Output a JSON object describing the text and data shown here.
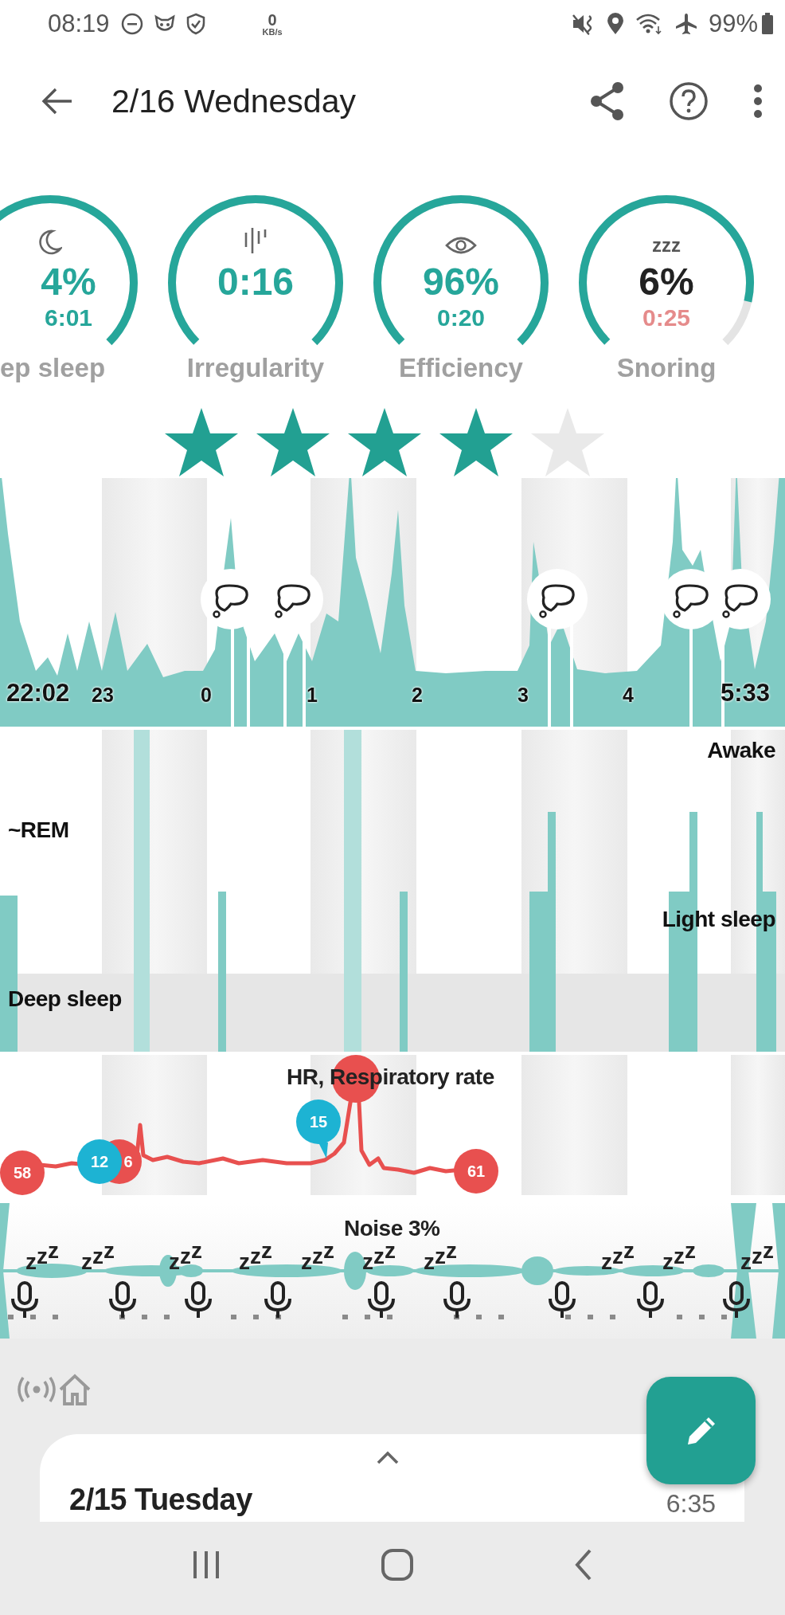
{
  "status_bar": {
    "time": "08:19",
    "net_speed": "0",
    "net_unit": "KB/s",
    "battery": "99%"
  },
  "app_bar": {
    "title": "2/16 Wednesday"
  },
  "gauges": [
    {
      "kind": "moon",
      "value": "4%",
      "detail": "6:01",
      "label": "ep sleep",
      "level": 1,
      "warning": false
    },
    {
      "kind": "bars",
      "value": "0:16",
      "label": "Irregularity",
      "level": 1,
      "warning": false
    },
    {
      "kind": "eye",
      "value": "96%",
      "detail": "0:20",
      "label": "Efficiency",
      "level": 1,
      "warning": false
    },
    {
      "kind": "snore",
      "icon_text": "zzz",
      "value": "6%",
      "detail": "0:25",
      "label": "Snoring",
      "level": 0.88,
      "warning": true
    }
  ],
  "rating": {
    "stars": 4
  },
  "activity_chart": {
    "time_labels": [
      "22:02",
      "23",
      "0",
      "1",
      "2",
      "3",
      "4",
      "5:33"
    ]
  },
  "sleep_stages": {
    "labels": [
      "Awake",
      "~REM",
      "Light sleep",
      "Deep sleep"
    ]
  },
  "hr_chart": {
    "title": "HR, Respiratory rate",
    "markers": [
      {
        "text": "58",
        "color": "#e8504f"
      },
      {
        "text": "6",
        "color": "#e8504f"
      },
      {
        "text": "12",
        "color": "#1db3d3"
      },
      {
        "text": "15",
        "color": "#1db3d3"
      },
      {
        "text": "61",
        "color": "#e8504f"
      }
    ]
  },
  "noise": {
    "title": "Noise 3%",
    "snore_marks": [
      "zzz",
      "zzz",
      "zzz",
      "zzz",
      "zzz",
      "zzz",
      "zzz",
      "zzz",
      "zzz",
      "zzz"
    ]
  },
  "previous_day": {
    "title": "2/15 Tuesday",
    "time": "6:35"
  }
}
